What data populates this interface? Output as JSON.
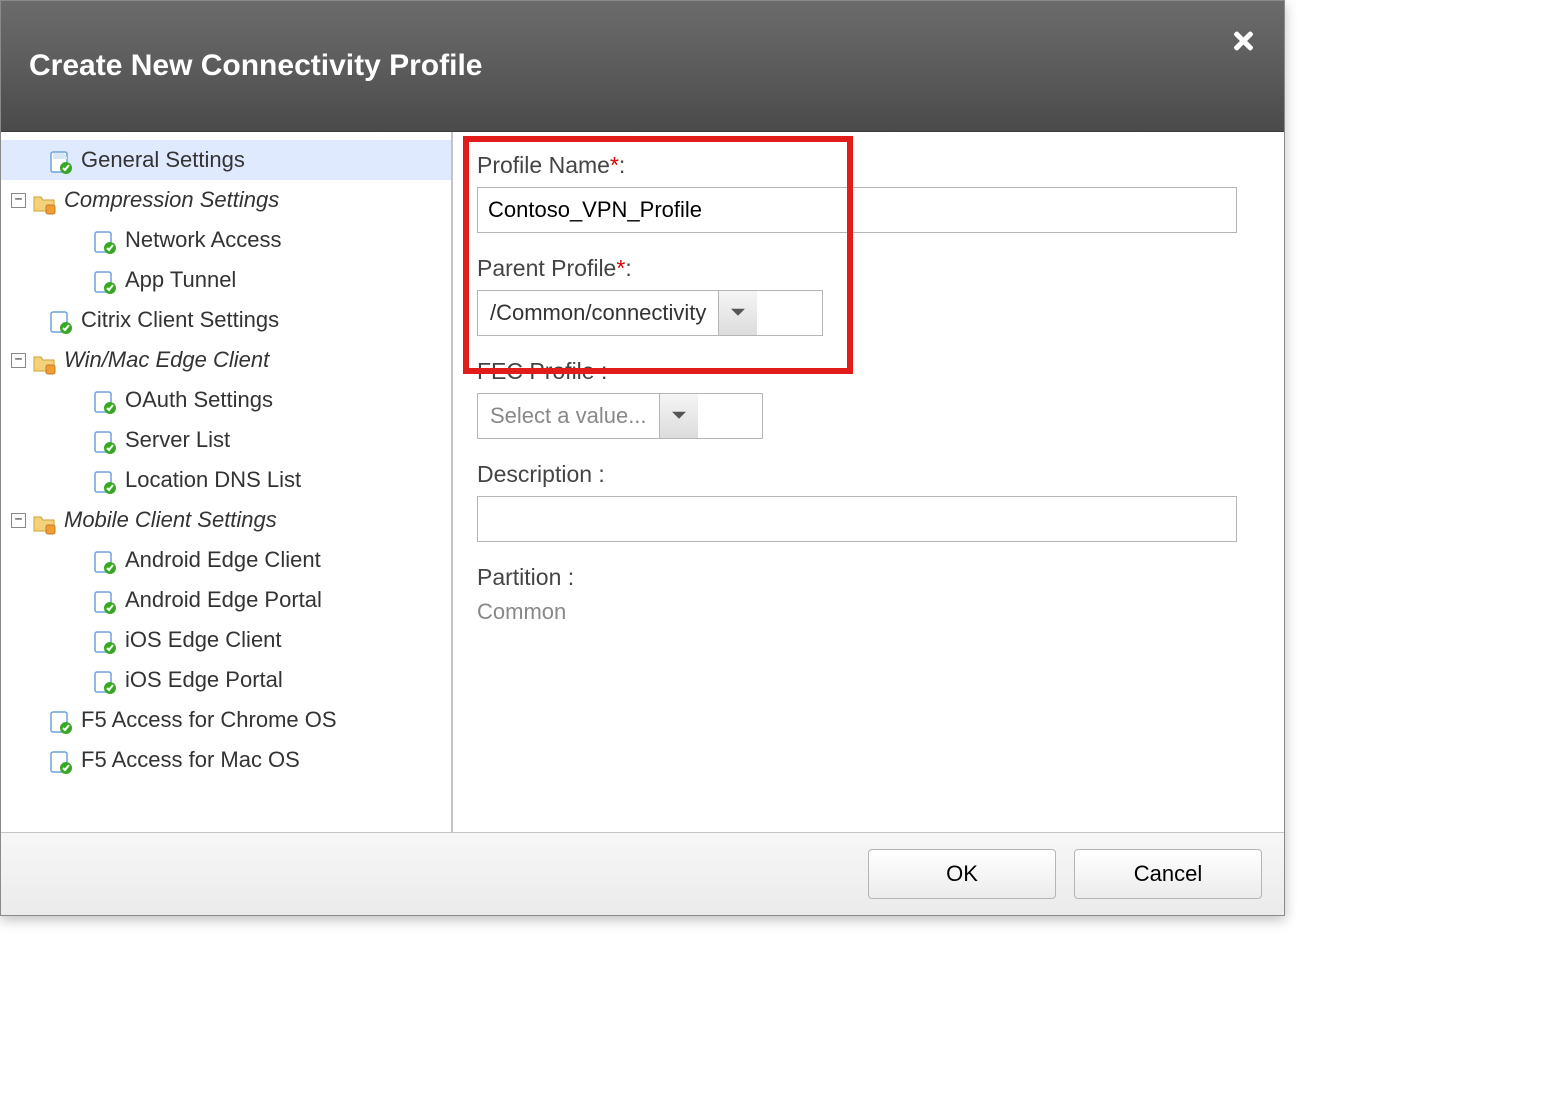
{
  "dialog": {
    "title": "Create New Connectivity Profile"
  },
  "tree": {
    "items": [
      {
        "label": "General Settings"
      },
      {
        "label": "Compression Settings"
      },
      {
        "label": "Network Access"
      },
      {
        "label": "App Tunnel"
      },
      {
        "label": "Citrix Client Settings"
      },
      {
        "label": "Win/Mac Edge Client"
      },
      {
        "label": "OAuth Settings"
      },
      {
        "label": "Server List"
      },
      {
        "label": "Location DNS List"
      },
      {
        "label": "Mobile Client Settings"
      },
      {
        "label": "Android Edge Client"
      },
      {
        "label": "Android Edge Portal"
      },
      {
        "label": "iOS Edge Client"
      },
      {
        "label": "iOS Edge Portal"
      },
      {
        "label": "F5 Access for Chrome OS"
      },
      {
        "label": "F5 Access for Mac OS"
      }
    ]
  },
  "form": {
    "profile_name_label": "Profile Name",
    "profile_name_value": "Contoso_VPN_Profile",
    "parent_profile_label": "Parent Profile",
    "parent_profile_value": "/Common/connectivity",
    "fec_profile_label": "FEC Profile  :",
    "fec_profile_placeholder": "Select a value...",
    "description_label": "Description  :",
    "description_value": "",
    "partition_label": "Partition  :",
    "partition_value": "Common",
    "required_mark": "*",
    "colon": ":"
  },
  "footer": {
    "ok_label": "OK",
    "cancel_label": "Cancel"
  }
}
